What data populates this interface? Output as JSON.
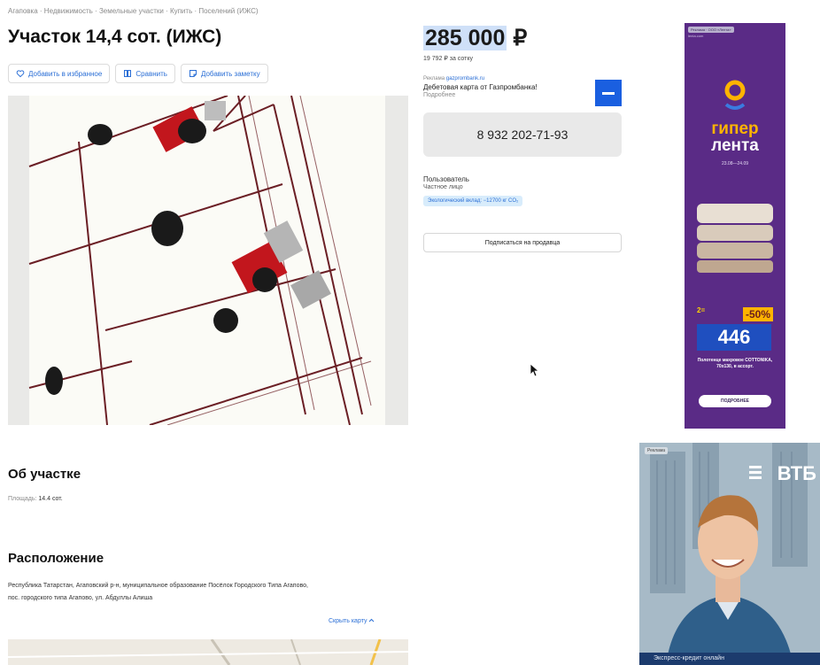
{
  "breadcrumb": "Агаповка · Недвижимость · Земельные участки · Купить · Поселений (ИЖС)",
  "title": "Участок 14,4 сот. (ИЖС)",
  "actions": {
    "favorite": "Добавить в избранное",
    "compare": "Сравнить",
    "note": "Добавить заметку"
  },
  "price": {
    "value": "285 000",
    "currency": "₽",
    "per_unit": "19 792 ₽ за сотку"
  },
  "promo": {
    "tag_prefix": "Реклама",
    "tag_link": "gazprombank.ru",
    "text": "Дебетовая карта от Газпромбанка!",
    "more": "Подробнее"
  },
  "phone": "8 932 202-71-93",
  "seller": {
    "name": "Пользователь",
    "type": "Частное лицо",
    "eco": "Экологический вклад: −12700 кг CO₂"
  },
  "subscribe": "Подписаться на продавца",
  "about": {
    "heading": "Об участке",
    "area_label": "Площадь:",
    "area_value": "14.4 сот."
  },
  "location": {
    "heading": "Расположение",
    "address": "Республика Татарстан, Агаповский р-н, муниципальное образование Посёлок Городского Типа Агапово, пос. городского типа Агапово, ул. Абдуллы Алиша",
    "hide_map": "Скрыть карту"
  },
  "ad_lenta": {
    "chip": "Реклама · ООО «Лента»",
    "chip2": "lenta.com",
    "brand1": "гипер",
    "brand2": "лента",
    "dates": "23.08—24.09",
    "twofor": "2=",
    "discount": "-50%",
    "price": "446",
    "desc": "Полотенце махровое COTTONIKA, 70х130, в ассорт.",
    "cta": "ПОДРОБНЕЕ",
    "colors": {
      "bg": "#5a2b86",
      "accent": "#ffb400",
      "price_bg": "#1f4fbf"
    }
  },
  "ad_vtb": {
    "chip": "Реклама",
    "logo": "ВТБ",
    "caption": "Экспресс-кредит онлайн"
  },
  "icons": {
    "favorite": "heart-icon",
    "compare": "compare-icon",
    "note": "note-icon",
    "cursor": "mouse-pointer-icon"
  },
  "colors": {
    "link": "#2b6fd6",
    "price_highlight": "#cfe0f8",
    "phone_bg": "#e9e9e9"
  }
}
